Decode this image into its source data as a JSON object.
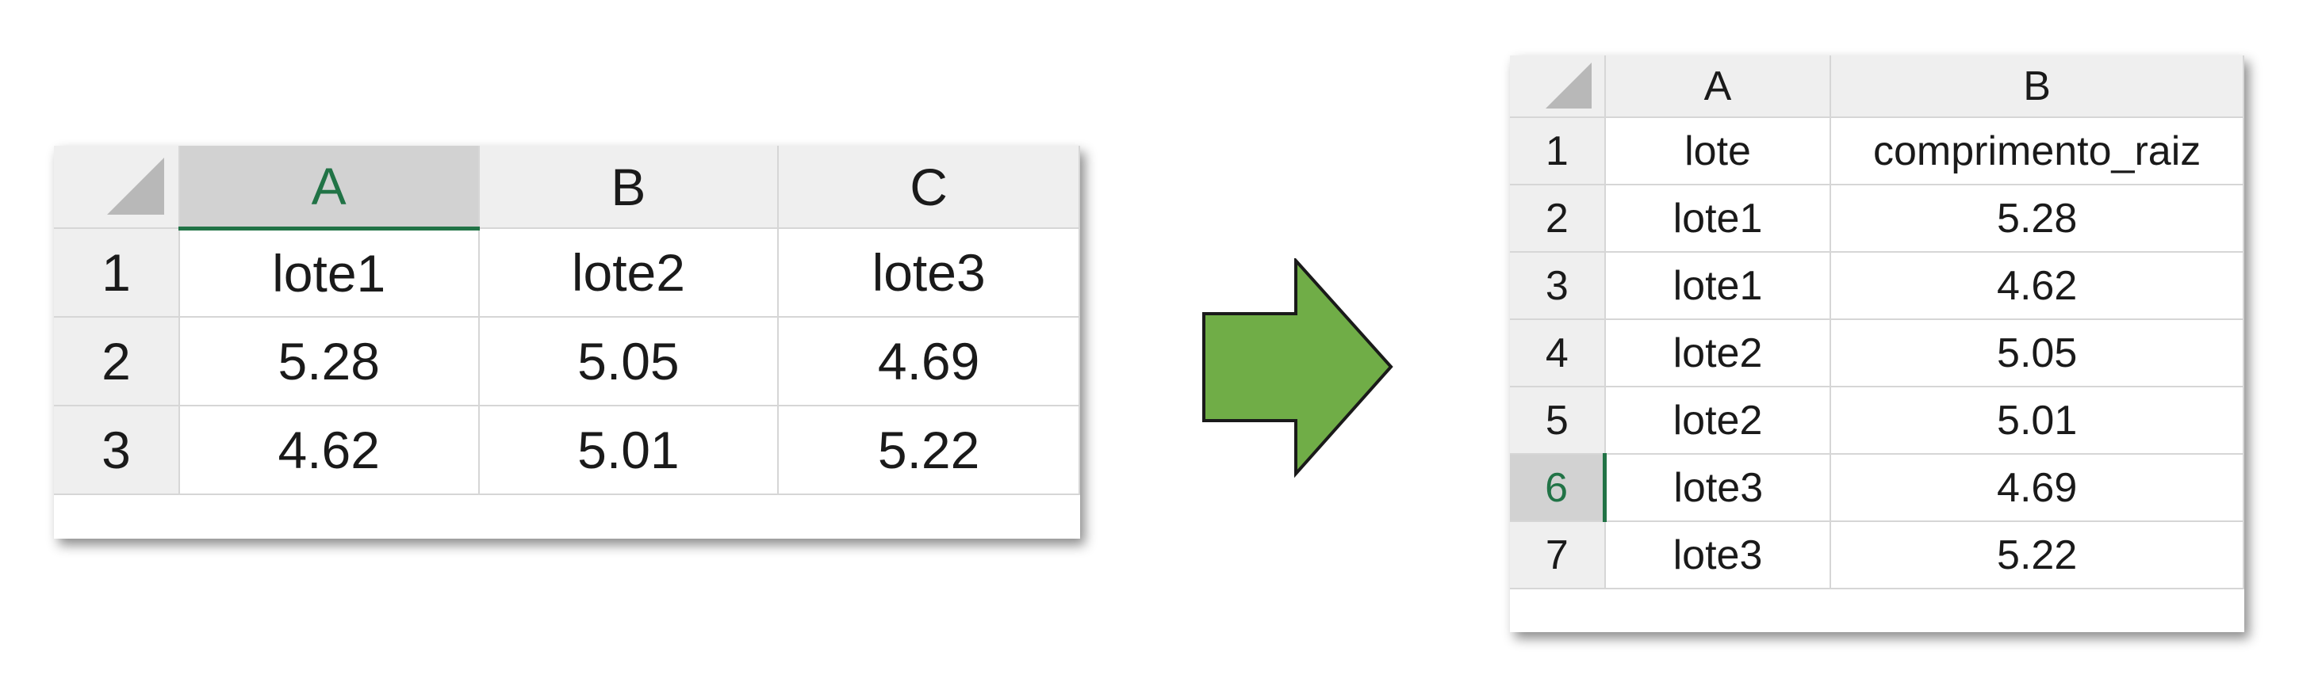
{
  "wide_table": {
    "column_headers": [
      "A",
      "B",
      "C"
    ],
    "selected_column": "A",
    "rows": [
      {
        "row_number": "1",
        "cells": [
          "lote1",
          "lote2",
          "lote3"
        ]
      },
      {
        "row_number": "2",
        "cells": [
          "5.28",
          "5.05",
          "4.69"
        ]
      },
      {
        "row_number": "3",
        "cells": [
          "4.62",
          "5.01",
          "5.22"
        ]
      }
    ]
  },
  "arrow": {
    "icon": "right-arrow-icon",
    "color": "#70ad47"
  },
  "long_table": {
    "column_headers": [
      "A",
      "B"
    ],
    "selected_row": "6",
    "rows": [
      {
        "row_number": "1",
        "cells": [
          "lote",
          "comprimento_raiz"
        ]
      },
      {
        "row_number": "2",
        "cells": [
          "lote1",
          "5.28"
        ]
      },
      {
        "row_number": "3",
        "cells": [
          "lote1",
          "4.62"
        ]
      },
      {
        "row_number": "4",
        "cells": [
          "lote2",
          "5.05"
        ]
      },
      {
        "row_number": "5",
        "cells": [
          "lote2",
          "5.01"
        ]
      },
      {
        "row_number": "6",
        "cells": [
          "lote3",
          "4.69"
        ]
      },
      {
        "row_number": "7",
        "cells": [
          "lote3",
          "5.22"
        ]
      }
    ]
  },
  "colors": {
    "header_bg": "#efefef",
    "selected_header_bg": "#d2d2d2",
    "selection_accent": "#217346",
    "gridline": "#d6d6d6"
  }
}
